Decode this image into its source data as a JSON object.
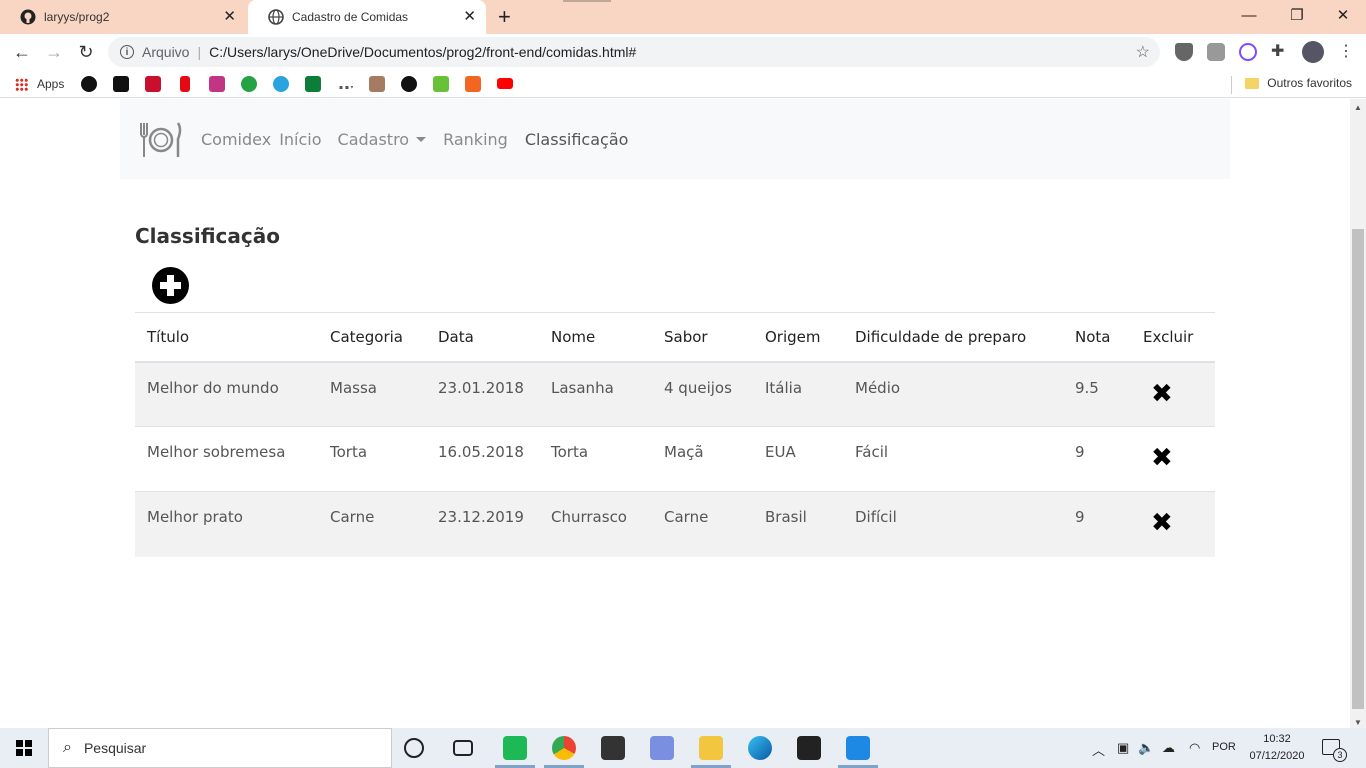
{
  "browser": {
    "tabs": [
      {
        "title": "laryys/prog2",
        "active": false
      },
      {
        "title": "Cadastro de Comidas",
        "active": true
      }
    ],
    "address": {
      "scheme_label": "Arquivo",
      "url": "C:/Users/larys/OneDrive/Documentos/prog2/front-end/comidas.html#"
    },
    "bookmarks": {
      "apps_label": "Apps",
      "other_label": "Outros favoritos"
    }
  },
  "navbar": {
    "brand": "Comidex",
    "items": [
      {
        "label": "Início"
      },
      {
        "label": "Cadastro"
      },
      {
        "label": "Ranking"
      },
      {
        "label": "Classificação"
      }
    ]
  },
  "page": {
    "heading": "Classificação"
  },
  "table": {
    "headers": [
      "Título",
      "Categoria",
      "Data",
      "Nome",
      "Sabor",
      "Origem",
      "Dificuldade de preparo",
      "Nota",
      "Excluir"
    ],
    "rows": [
      [
        "Melhor do mundo",
        "Massa",
        "23.01.2018",
        "Lasanha",
        "4 queijos",
        "Itália",
        "Médio",
        "9.5"
      ],
      [
        "Melhor sobremesa",
        "Torta",
        "16.05.2018",
        "Torta",
        "Maçã",
        "EUA",
        "Fácil",
        "9"
      ],
      [
        "Melhor prato",
        "Carne",
        "23.12.2019",
        "Churrasco",
        "Carne",
        "Brasil",
        "Difícil",
        "9"
      ]
    ],
    "delete_glyph": "✖"
  },
  "taskbar": {
    "search_placeholder": "Pesquisar",
    "language": "POR",
    "time": "10:32",
    "date": "07/12/2020",
    "notifications": "3"
  }
}
